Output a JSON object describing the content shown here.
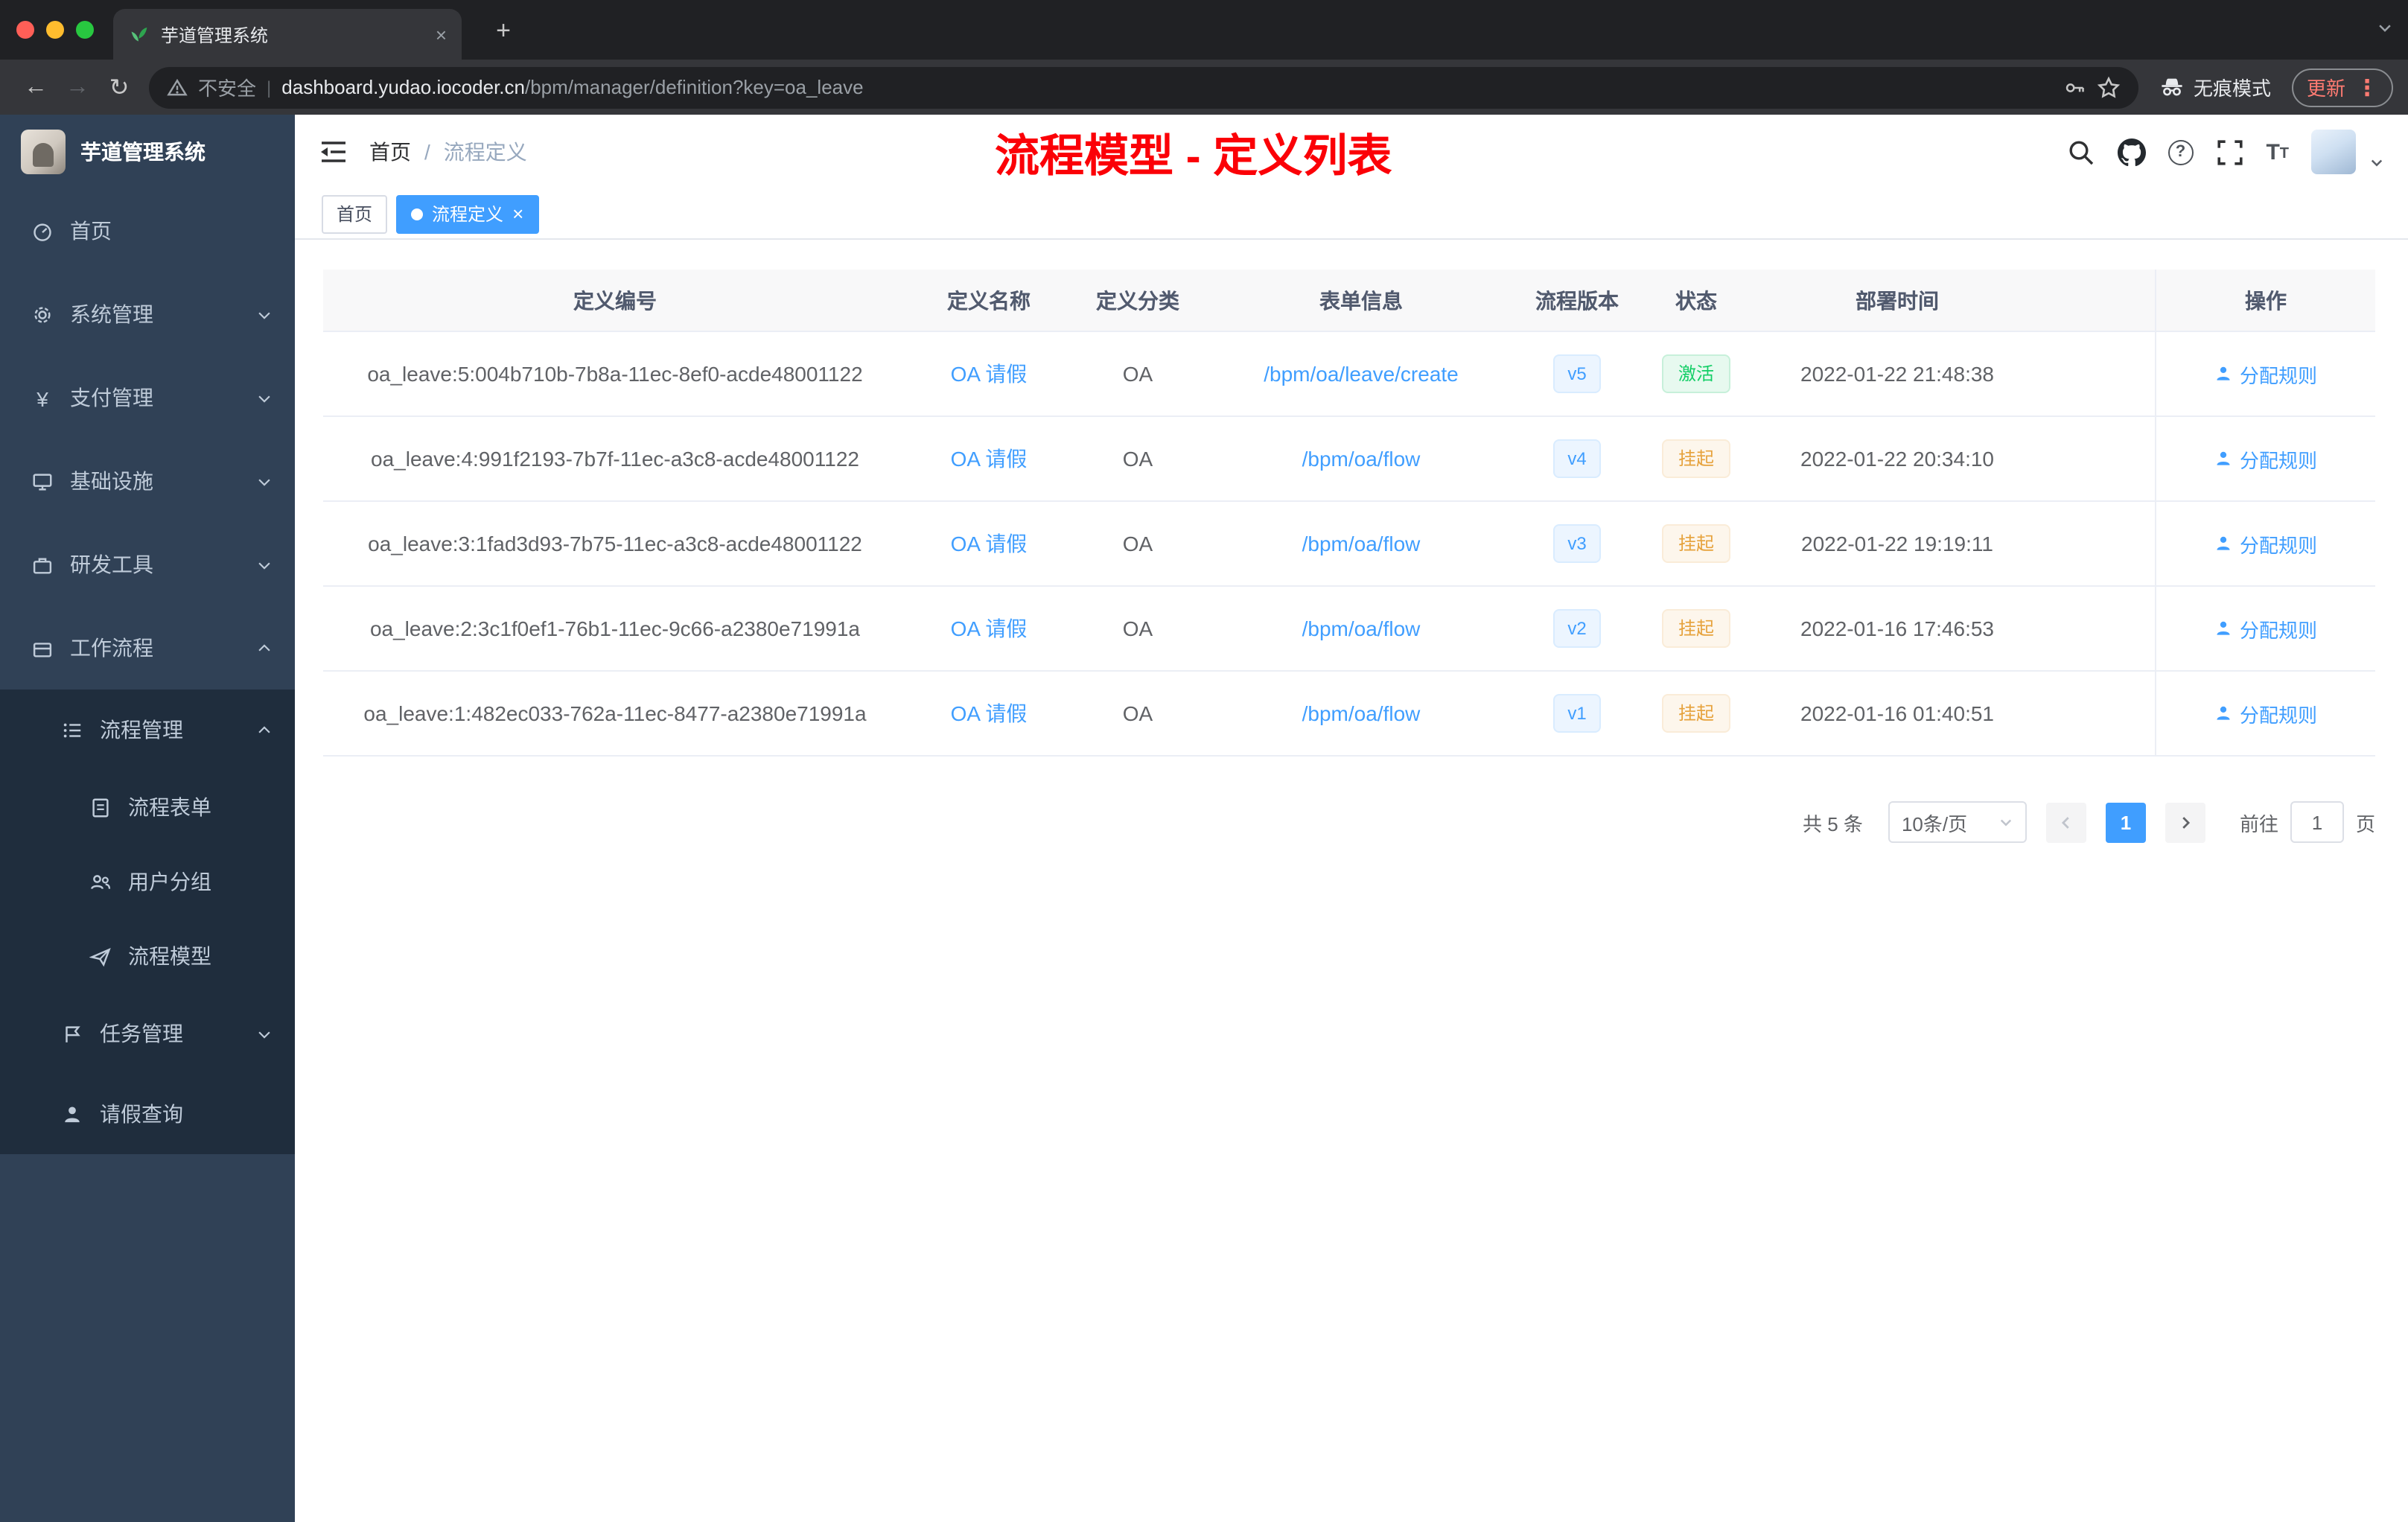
{
  "browser": {
    "tab": {
      "title": "芋道管理系统"
    },
    "address": {
      "security": "不安全",
      "host": "dashboard.yudao.iocoder.cn",
      "path": "/bpm/manager/definition?key=oa_leave"
    },
    "incognito_label": "无痕模式",
    "update_label": "更新"
  },
  "icons": {
    "back": "←",
    "forward": "→",
    "reload": "↻",
    "new_tab": "+",
    "tab_close": "×",
    "tag_close": "×",
    "kebab": "⋮",
    "yen": "¥",
    "help": "?",
    "font_large": "T",
    "font_small": "T",
    "url_divider": "|"
  },
  "sidebar": {
    "logo_title": "芋道管理系统",
    "items": [
      {
        "label": "首页"
      },
      {
        "label": "系统管理"
      },
      {
        "label": "支付管理"
      },
      {
        "label": "基础设施"
      },
      {
        "label": "研发工具"
      },
      {
        "label": "工作流程"
      },
      {
        "label": "流程管理"
      },
      {
        "label": "流程表单"
      },
      {
        "label": "用户分组"
      },
      {
        "label": "流程模型"
      },
      {
        "label": "任务管理"
      },
      {
        "label": "请假查询"
      }
    ]
  },
  "header": {
    "breadcrumb": {
      "home": "首页",
      "separator": "/",
      "current": "流程定义"
    },
    "annotation": "流程模型 - 定义列表"
  },
  "tags": {
    "items": [
      {
        "label": "首页"
      },
      {
        "label": "流程定义"
      }
    ]
  },
  "table": {
    "columns": {
      "id": "定义编号",
      "name": "定义名称",
      "category": "定义分类",
      "form": "表单信息",
      "version": "流程版本",
      "status": "状态",
      "deploy_time": "部署时间",
      "actions": "操作"
    },
    "rows": [
      {
        "id": "oa_leave:5:004b710b-7b8a-11ec-8ef0-acde48001122",
        "name": "OA 请假",
        "category": "OA",
        "form": "/bpm/oa/leave/create",
        "version": "v5",
        "status": "激活",
        "status_type": "active",
        "deploy_time": "2022-01-22 21:48:38",
        "action": "分配规则"
      },
      {
        "id": "oa_leave:4:991f2193-7b7f-11ec-a3c8-acde48001122",
        "name": "OA 请假",
        "category": "OA",
        "form": "/bpm/oa/flow",
        "version": "v4",
        "status": "挂起",
        "status_type": "suspended",
        "deploy_time": "2022-01-22 20:34:10",
        "action": "分配规则"
      },
      {
        "id": "oa_leave:3:1fad3d93-7b75-11ec-a3c8-acde48001122",
        "name": "OA 请假",
        "category": "OA",
        "form": "/bpm/oa/flow",
        "version": "v3",
        "status": "挂起",
        "status_type": "suspended",
        "deploy_time": "2022-01-22 19:19:11",
        "action": "分配规则"
      },
      {
        "id": "oa_leave:2:3c1f0ef1-76b1-11ec-9c66-a2380e71991a",
        "name": "OA 请假",
        "category": "OA",
        "form": "/bpm/oa/flow",
        "version": "v2",
        "status": "挂起",
        "status_type": "suspended",
        "deploy_time": "2022-01-16 17:46:53",
        "action": "分配规则"
      },
      {
        "id": "oa_leave:1:482ec033-762a-11ec-8477-a2380e71991a",
        "name": "OA 请假",
        "category": "OA",
        "form": "/bpm/oa/flow",
        "version": "v1",
        "status": "挂起",
        "status_type": "suspended",
        "deploy_time": "2022-01-16 01:40:51",
        "action": "分配规则"
      }
    ]
  },
  "pagination": {
    "total": "共 5 条",
    "page_size": "10条/页",
    "page": "1",
    "goto_label": "前往",
    "goto_value": "1",
    "page_unit": "页"
  },
  "colors": {
    "accent": "#409eff",
    "annotation_red": "#fb0007",
    "status_active": "#13ce66",
    "status_suspended": "#e6a23c",
    "sidebar_bg": "#304156",
    "submenu_bg": "#1f2d3d"
  }
}
